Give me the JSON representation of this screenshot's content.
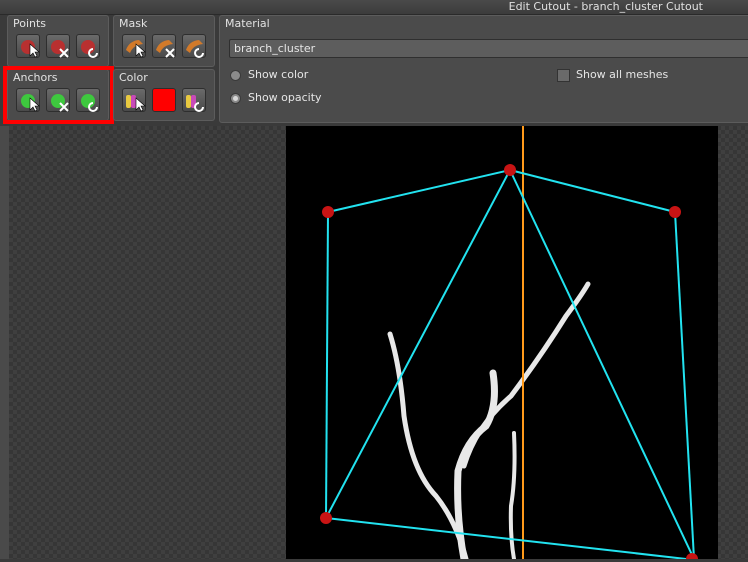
{
  "window": {
    "title": "Edit Cutout - branch_cluster Cutout"
  },
  "groups": {
    "points": {
      "label": "Points"
    },
    "mask": {
      "label": "Mask"
    },
    "material": {
      "label": "Material"
    },
    "anchors": {
      "label": "Anchors"
    },
    "color": {
      "label": "Color"
    }
  },
  "material": {
    "value": "branch_cluster",
    "show_color": "Show color",
    "show_opacity": "Show opacity",
    "show_all_meshes": "Show all  meshes",
    "selected_mode": "Show opacity"
  },
  "colors": {
    "wire": "#22e3f0",
    "guide": "#ff9a1a",
    "point": "#c81414",
    "swatch": "#ff0000",
    "highlight": "#ff0000"
  }
}
